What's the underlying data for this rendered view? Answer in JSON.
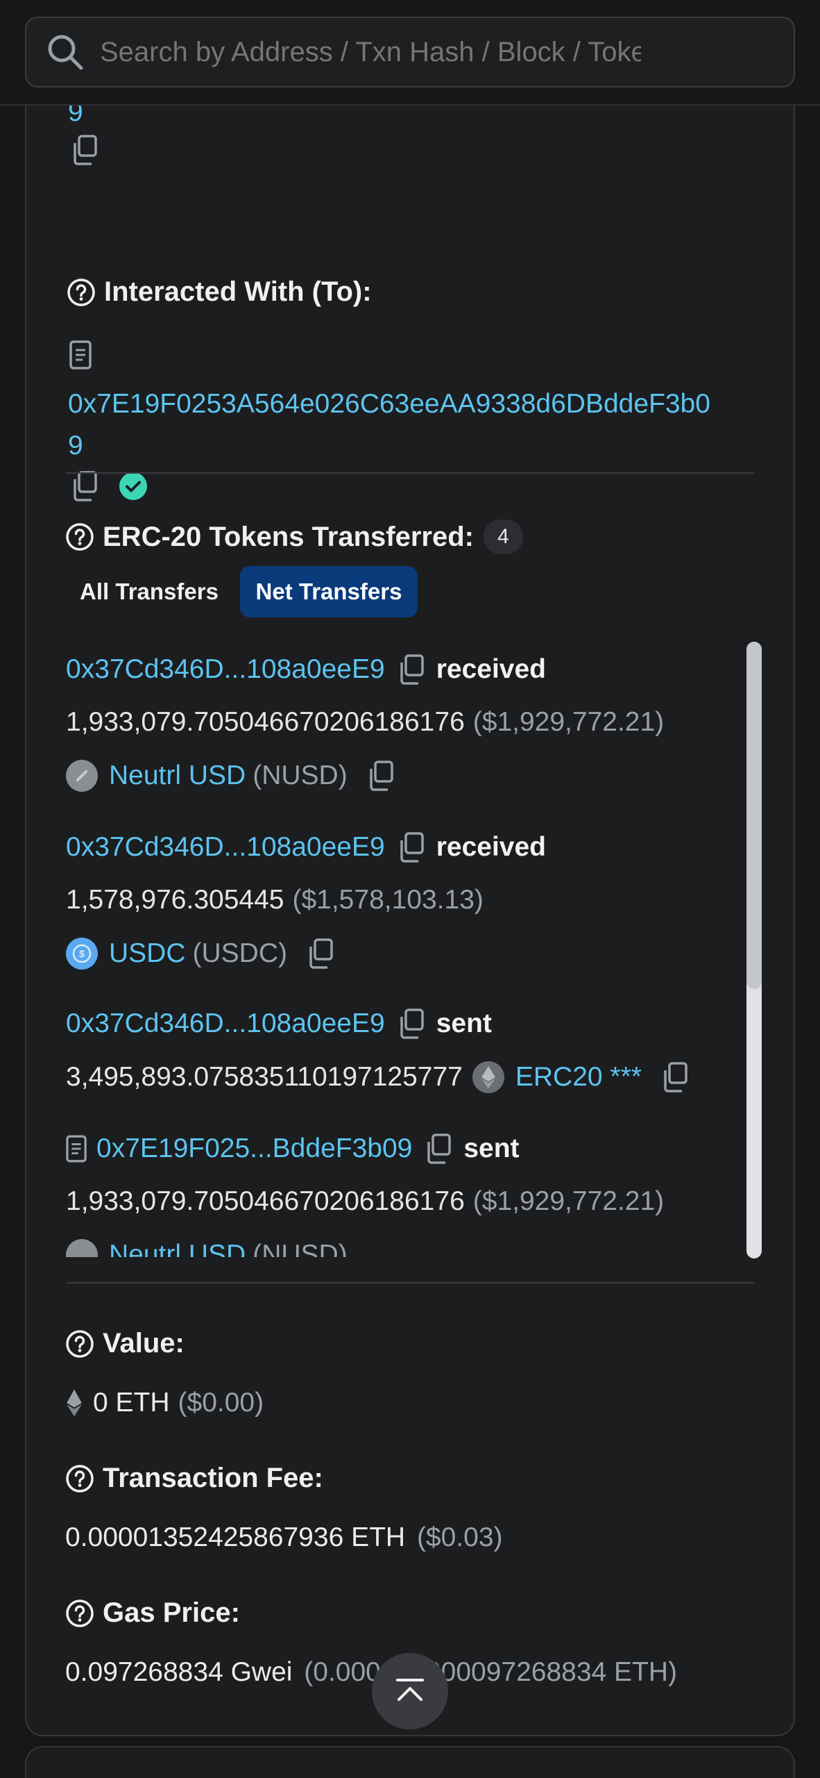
{
  "search": {
    "placeholder": "Search by Address / Txn Hash / Block / Token"
  },
  "from_tail": {
    "address_wrap": "9"
  },
  "interacted_with": {
    "label": "Interacted With (To):",
    "address_line1": "0x7E19F0253A564e026C63eeAA9338d6DBddeF3b0",
    "address_line2": "9"
  },
  "erc20": {
    "label": "ERC-20 Tokens Transferred:",
    "count": "4",
    "tabs": [
      {
        "label": "All Transfers",
        "active": false
      },
      {
        "label": "Net Transfers",
        "active": true
      }
    ],
    "transfers": [
      {
        "address": "0x37Cd346D...108a0eeE9",
        "direction": "received",
        "amount": "1,933,079.705046670206186176",
        "usd": "($1,929,772.21)",
        "token_name": "Neutrl USD",
        "token_symbol": "(NUSD)"
      },
      {
        "address": "0x37Cd346D...108a0eeE9",
        "direction": "received",
        "amount": "1,578,976.305445",
        "usd": "($1,578,103.13)",
        "token_name": "USDC",
        "token_symbol": "(USDC)"
      },
      {
        "address": "0x37Cd346D...108a0eeE9",
        "direction": "sent",
        "amount": "3,495,893.075835110197125777",
        "token_name": "ERC20 ***"
      },
      {
        "address": "0x7E19F025...BddeF3b09",
        "direction": "sent",
        "amount": "1,933,079.705046670206186176",
        "usd": "($1,929,772.21)",
        "token_name": "Neutrl USD",
        "token_symbol": "(NUSD)"
      }
    ]
  },
  "value": {
    "label": "Value:",
    "amount": "0 ETH",
    "usd": "($0.00)"
  },
  "fee": {
    "label": "Transaction Fee:",
    "amount": "0.00001352425867936 ETH",
    "usd": "($0.03)"
  },
  "gas": {
    "label": "Gas Price:",
    "amount": "0.097268834 Gwei",
    "detail": "(0.000000000097268834 ETH)"
  },
  "colors": {
    "link": "#5cc4f0",
    "accent_tab": "#0a3a7a",
    "verified": "#3dd6b5",
    "background": "#161718"
  }
}
